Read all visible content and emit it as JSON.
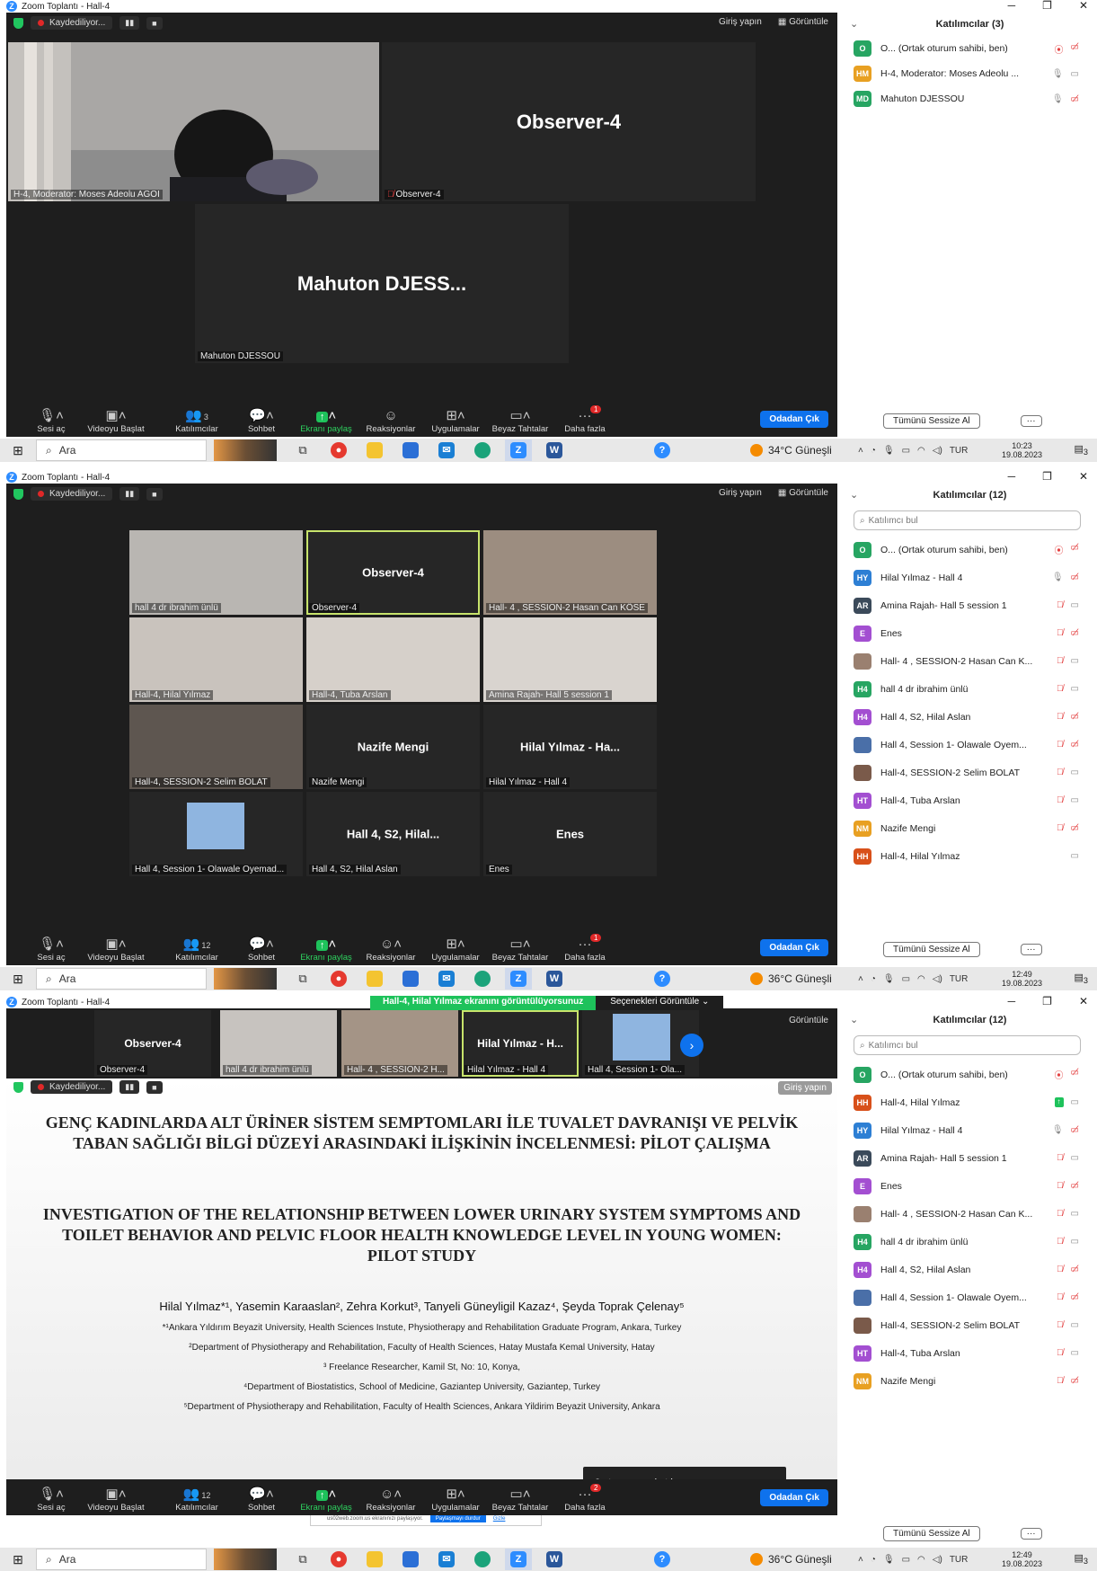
{
  "window_title": "Zoom Toplantı - Hall-4",
  "window_controls": [
    "─",
    "❐",
    "✕"
  ],
  "recording_label": "Kaydediliyor...",
  "recording_controls": [
    "▮▮",
    "■"
  ],
  "sign_in": "Giriş yapın",
  "view_label": "Görüntüle",
  "toolbar": {
    "mute": "Sesi aç",
    "video": "Videoyu Başlat",
    "participants": "Katılımcılar",
    "chat": "Sohbet",
    "share": "Ekranı paylaş",
    "reactions": "Reaksiyonlar",
    "apps": "Uygulamalar",
    "whiteboards": "Beyaz Tahtalar",
    "more": "Daha fazla",
    "leave": "Odadan Çık"
  },
  "panel": {
    "mute_all": "Tümünü Sessize Al",
    "more": "···",
    "search_placeholder": "Katılımcı bul"
  },
  "taskbar": {
    "search": "Ara",
    "lang": "TUR"
  },
  "shot1": {
    "panel_title": "Katılımcılar (3)",
    "participants_count": "3",
    "more_badge": "1",
    "tiles": [
      {
        "big": "",
        "label": "H-4, Moderator: Moses Adeolu AGOI"
      },
      {
        "big": "Observer-4",
        "label": "Observer-4"
      },
      {
        "big": "Mahuton  DJESS...",
        "label": "Mahuton DJESSOU"
      }
    ],
    "participants": [
      {
        "initials": "O",
        "color": "#27a562",
        "name": "O... (Ortak oturum sahibi, ben)"
      },
      {
        "initials": "HM",
        "color": "#e8a022",
        "name": "H-4, Moderator: Moses Adeolu ..."
      },
      {
        "initials": "MD",
        "color": "#27a562",
        "name": "Mahuton DJESSOU"
      }
    ],
    "weather": "34°C Güneşli",
    "time": "10:23",
    "date": "19.08.2023",
    "notif": "3"
  },
  "shot2": {
    "panel_title": "Katılımcılar (12)",
    "participants_count": "12",
    "more_badge": "1",
    "tiles": [
      {
        "big": "",
        "label": "hall 4 dr ibrahim ünlü"
      },
      {
        "big": "Observer-4",
        "label": "Observer-4"
      },
      {
        "big": "",
        "label": "Hall- 4 , SESSION-2 Hasan Can KÖSE"
      },
      {
        "big": "",
        "label": "Hall-4, Hilal Yılmaz"
      },
      {
        "big": "",
        "label": "Hall-4, Tuba Arslan"
      },
      {
        "big": "",
        "label": "Amina Rajah- Hall 5 session 1"
      },
      {
        "big": "",
        "label": "Hall-4, SESSION-2 Selim BOLAT"
      },
      {
        "big": "Nazife Mengi",
        "label": "Nazife Mengi"
      },
      {
        "big": "Hilal Yılmaz - Ha...",
        "label": "Hilal Yılmaz - Hall 4"
      },
      {
        "big": "",
        "label": "Hall 4, Session 1- Olawale Oyemad..."
      },
      {
        "big": "Hall 4, S2, Hilal...",
        "label": "Hall 4, S2, Hilal Aslan"
      },
      {
        "big": "Enes",
        "label": "Enes"
      }
    ],
    "participants": [
      {
        "initials": "O",
        "color": "#27a562",
        "name": "O... (Ortak oturum sahibi, ben)"
      },
      {
        "initials": "HY",
        "color": "#2d7fd4",
        "name": "Hilal Yılmaz - Hall 4"
      },
      {
        "initials": "AR",
        "color": "#3b4a5a",
        "name": "Amina Rajah- Hall 5 session 1"
      },
      {
        "initials": "E",
        "color": "#a34fd1",
        "name": "Enes"
      },
      {
        "initials": "",
        "color": "#9a8070",
        "name": "Hall- 4 , SESSION-2 Hasan Can K..."
      },
      {
        "initials": "H4",
        "color": "#27a562",
        "name": "hall 4 dr ibrahim ünlü"
      },
      {
        "initials": "H4",
        "color": "#a34fd1",
        "name": "Hall 4, S2, Hilal Aslan"
      },
      {
        "initials": "",
        "color": "#4a6fa8",
        "name": "Hall 4, Session 1- Olawale Oyem..."
      },
      {
        "initials": "",
        "color": "#7a5a4a",
        "name": "Hall-4, SESSION-2 Selim BOLAT"
      },
      {
        "initials": "HT",
        "color": "#a34fd1",
        "name": "Hall-4, Tuba Arslan"
      },
      {
        "initials": "NM",
        "color": "#e8a022",
        "name": "Nazife Mengi"
      },
      {
        "initials": "HH",
        "color": "#d8501a",
        "name": "Hall-4, Hilal Yılmaz"
      }
    ],
    "weather": "36°C Güneşli",
    "time": "12:49",
    "date": "19.08.2023",
    "notif": "3"
  },
  "shot3": {
    "panel_title": "Katılımcılar (12)",
    "participants_count": "12",
    "more_badge": "2",
    "banner": "Hall-4, Hilal Yılmaz ekranını görüntülüyorsunuz",
    "view_options": "Seçenekleri Görüntüle",
    "strip": [
      {
        "big": "Observer-4",
        "label": "Observer-4"
      },
      {
        "big": "",
        "label": "hall 4 dr ibrahim ünlü"
      },
      {
        "big": "",
        "label": "Hall- 4 , SESSION-2 H..."
      },
      {
        "big": "Hilal Yılmaz - H...",
        "label": "Hilal Yılmaz - Hall 4"
      },
      {
        "big": "",
        "label": "Hall 4, Session 1- Ola..."
      }
    ],
    "slide": {
      "title_tr": "GENÇ KADINLARDA ALT ÜRİNER SİSTEM SEMPTOMLARI İLE TUVALET DAVRANIŞI VE PELVİK TABAN SAĞLIĞI BİLGİ DÜZEYİ ARASINDAKİ İLİŞKİNİN İNCELENMESİ: PİLOT ÇALIŞMA",
      "title_en": "INVESTIGATION OF THE RELATIONSHIP BETWEEN LOWER URINARY SYSTEM SYMPTOMS AND TOILET BEHAVIOR AND PELVIC FLOOR HEALTH KNOWLEDGE LEVEL IN YOUNG WOMEN: PILOT STUDY",
      "authors": "Hilal Yılmaz*¹, Yasemin Karaaslan², Zehra Korkut³, Tanyeli Güneyligil Kazaz⁴, Şeyda Toprak Çelenay⁵",
      "affiliations": [
        "*¹Ankara Yıldırım Beyazit University, Health Sciences Instute, Physiotherapy and Rehabilitation Graduate Program, Ankara, Turkey",
        "²Department of Physiotherapy and Rehabilitation, Faculty of Health Sciences, Hatay Mustafa Kemal University, Hatay",
        "³ Freelance Researcher, Kamil St, No: 10, Konya,",
        "⁴Department of Biostatistics, School of Medicine, Gaziantep University,  Gaziantep, Turkey",
        "⁵Department of Physiotherapy and Rehabilitation, Faculty of Health Sciences, Ankara Yildirim Beyazit University, Ankara"
      ]
    },
    "tooltip": "2 atanmamış katılımcı",
    "sharebar_text": "us02web.zoom.us ekranınızı paylaşıyor.",
    "sharebar_stop": "Paylaşmayı durdur",
    "sharebar_hide": "Gizle",
    "participants": [
      {
        "initials": "O",
        "color": "#27a562",
        "name": "O... (Ortak oturum sahibi, ben)"
      },
      {
        "initials": "HH",
        "color": "#d8501a",
        "name": "Hall-4, Hilal Yılmaz"
      },
      {
        "initials": "HY",
        "color": "#2d7fd4",
        "name": "Hilal Yılmaz - Hall 4"
      },
      {
        "initials": "AR",
        "color": "#3b4a5a",
        "name": "Amina Rajah- Hall 5 session 1"
      },
      {
        "initials": "E",
        "color": "#a34fd1",
        "name": "Enes"
      },
      {
        "initials": "",
        "color": "#9a8070",
        "name": "Hall- 4 , SESSION-2 Hasan Can K..."
      },
      {
        "initials": "H4",
        "color": "#27a562",
        "name": "hall 4 dr ibrahim ünlü"
      },
      {
        "initials": "H4",
        "color": "#a34fd1",
        "name": "Hall 4, S2, Hilal Aslan"
      },
      {
        "initials": "",
        "color": "#4a6fa8",
        "name": "Hall 4, Session 1- Olawale Oyem..."
      },
      {
        "initials": "",
        "color": "#7a5a4a",
        "name": "Hall-4, SESSION-2 Selim BOLAT"
      },
      {
        "initials": "HT",
        "color": "#a34fd1",
        "name": "Hall-4, Tuba Arslan"
      },
      {
        "initials": "NM",
        "color": "#e8a022",
        "name": "Nazife Mengi"
      }
    ],
    "weather": "36°C Güneşli",
    "time": "12:49",
    "date": "19.08.2023",
    "notif": "3"
  }
}
